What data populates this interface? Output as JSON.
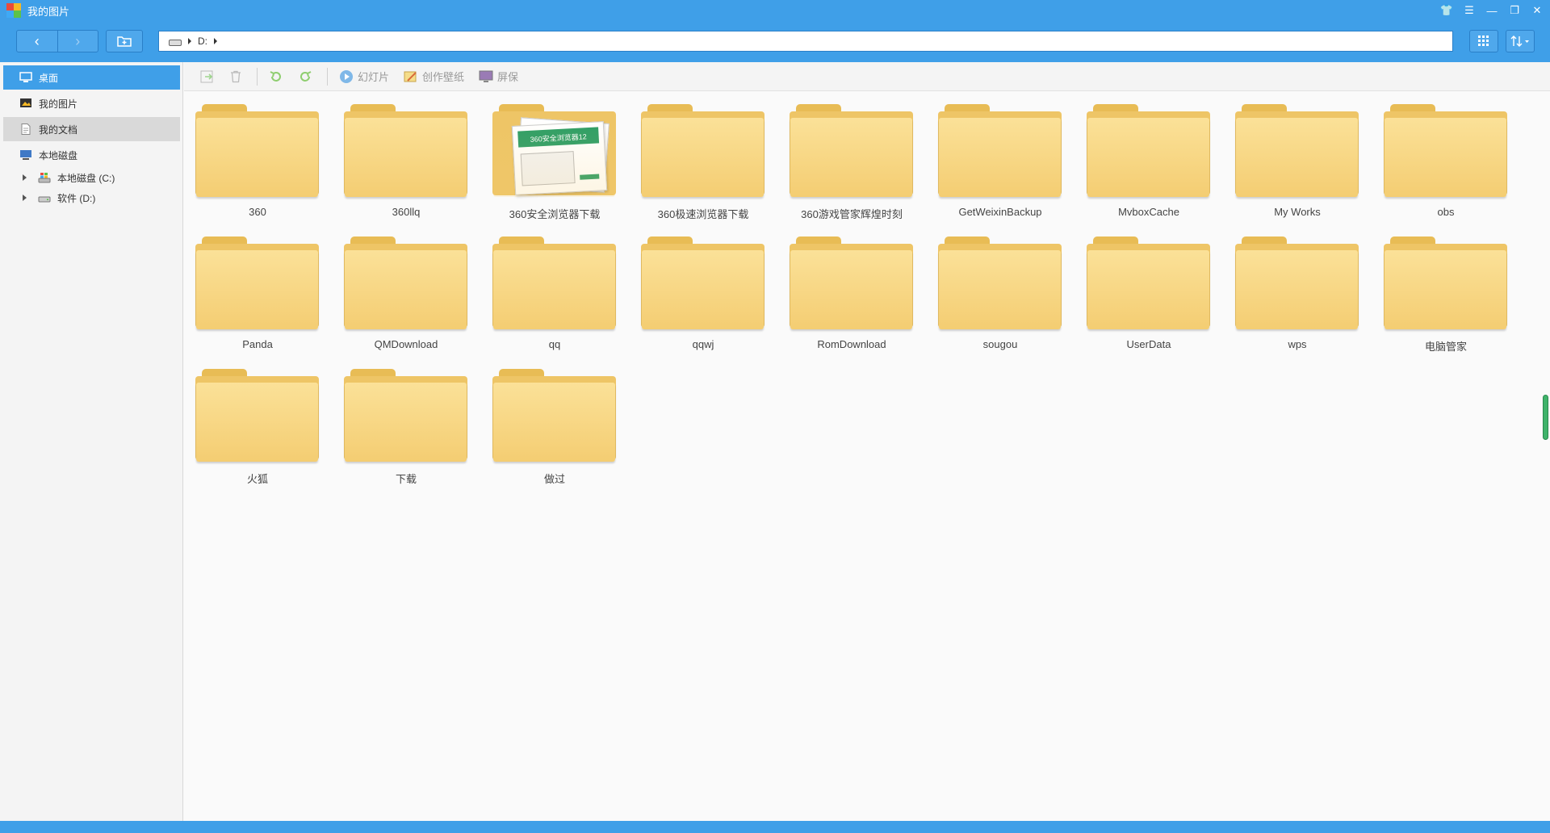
{
  "window": {
    "title": "我的图片",
    "controls": [
      "skin-icon",
      "menu-icon",
      "minimize-icon",
      "restore-icon",
      "close-icon"
    ]
  },
  "navbar": {
    "back_glyph": "‹",
    "forward_glyph": "›",
    "address": {
      "drive": "D:"
    }
  },
  "sidebar": {
    "items": [
      {
        "label": "桌面",
        "icon": "desktop-icon",
        "state": "active"
      },
      {
        "label": "我的图片",
        "icon": "pictures-icon",
        "state": "normal"
      },
      {
        "label": "我的文档",
        "icon": "documents-icon",
        "state": "hover"
      },
      {
        "label": "本地磁盘",
        "icon": "computer-icon",
        "state": "normal"
      }
    ],
    "drives": [
      {
        "label": "本地磁盘 (C:)",
        "icon": "system-drive-icon"
      },
      {
        "label": "软件 (D:)",
        "icon": "drive-icon"
      }
    ]
  },
  "toolbar": {
    "slideshow": "幻灯片",
    "wallpaper": "创作壁纸",
    "screensaver": "屏保"
  },
  "folders": [
    {
      "name": "360"
    },
    {
      "name": "360llq"
    },
    {
      "name": "360安全浏览器下载",
      "thumb": "360安全浏览器12"
    },
    {
      "name": "360极速浏览器下载"
    },
    {
      "name": "360游戏管家辉煌时刻"
    },
    {
      "name": "GetWeixinBackup"
    },
    {
      "name": "MvboxCache"
    },
    {
      "name": "My Works"
    },
    {
      "name": "obs"
    },
    {
      "name": "Panda"
    },
    {
      "name": "QMDownload"
    },
    {
      "name": "qq"
    },
    {
      "name": "qqwj"
    },
    {
      "name": "RomDownload"
    },
    {
      "name": "sougou"
    },
    {
      "name": "UserData"
    },
    {
      "name": "wps"
    },
    {
      "name": "电脑管家"
    },
    {
      "name": "火狐"
    },
    {
      "name": "下载"
    },
    {
      "name": "做过"
    }
  ],
  "colors": {
    "accent": "#3f9fe8",
    "folder": "#f4cd72",
    "scroll": "#3fb36a"
  }
}
